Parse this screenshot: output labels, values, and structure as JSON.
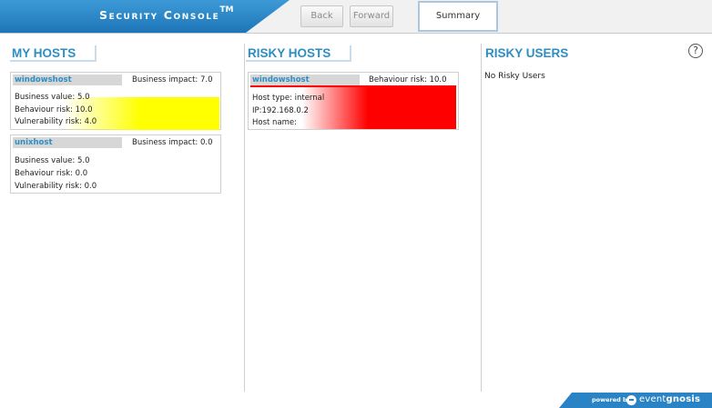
{
  "header": {
    "app_title": "Security Console",
    "trademark": "TM",
    "back_label": "Back",
    "forward_label": "Forward",
    "summary_tab": "Summary"
  },
  "help": {
    "symbol": "?"
  },
  "my_hosts": {
    "title": "MY HOSTS",
    "hosts": [
      {
        "name": "windowshost",
        "impact_label": "Business impact: 7.0",
        "business_value": "Business value: 5.0",
        "behaviour_risk": "Behaviour risk: 10.0",
        "vulnerability_risk": "Vulnerability risk: 4.0",
        "risk_color": "#ffff00"
      },
      {
        "name": "unixhost",
        "impact_label": "Business impact: 0.0",
        "business_value": "Business value: 5.0",
        "behaviour_risk": "Behaviour risk: 0.0",
        "vulnerability_risk": "Vulnerability risk: 0.0"
      }
    ]
  },
  "risky_hosts": {
    "title": "RISKY HOSTS",
    "hosts": [
      {
        "name": "windowshost",
        "risk_label": "Behaviour risk: 10.0",
        "host_type": "Host type: internal",
        "ip": "IP:192.168.0.2",
        "host_name": "Host name:",
        "risk_color": "#ff0000"
      }
    ]
  },
  "risky_users": {
    "title": "RISKY USERS",
    "empty_text": "No Risky Users"
  },
  "footer": {
    "powered_by": "powered by",
    "brand_light": "event",
    "brand_bold": "gnosis"
  }
}
